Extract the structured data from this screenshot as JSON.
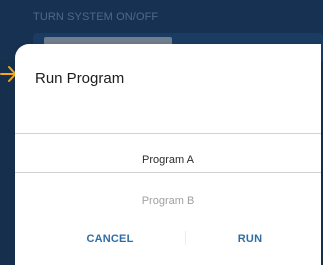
{
  "background": {
    "section_title": "TURN SYSTEM ON/OFF"
  },
  "dialog": {
    "title": "Run Program",
    "options": [
      "Program A",
      "Program B"
    ],
    "selected_option": "Program A",
    "cancel_label": "CANCEL",
    "run_label": "RUN"
  },
  "colors": {
    "background": "#16365a",
    "accent_button": "#2f6ea5",
    "pointer_arrow": "#f0a81c"
  },
  "icons": {
    "pointer": "arrow-right-icon"
  }
}
